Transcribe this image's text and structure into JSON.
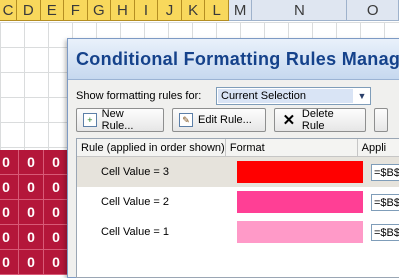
{
  "columns": [
    "C",
    "D",
    "E",
    "F",
    "G",
    "H",
    "I",
    "J",
    "K",
    "L",
    "M",
    "N",
    "O"
  ],
  "cell_value": "0",
  "dialog": {
    "title": "Conditional Formatting Rules Manager",
    "show_label": "Show formatting rules for:",
    "show_value": "Current Selection",
    "buttons": {
      "new_rule": "New Rule...",
      "edit_rule": "Edit Rule...",
      "delete_rule": "Delete Rule"
    },
    "headers": {
      "rule": "Rule (applied in order shown)",
      "format": "Format",
      "applies": "Appli"
    },
    "rules": [
      {
        "rule": "Cell Value = 3",
        "color": "#ff0000",
        "applies_to": "=$B$"
      },
      {
        "rule": "Cell Value = 2",
        "color": "#ff3f95",
        "applies_to": "=$B$"
      },
      {
        "rule": "Cell Value = 1",
        "color": "#ff9ac8",
        "applies_to": "=$B$"
      }
    ]
  }
}
